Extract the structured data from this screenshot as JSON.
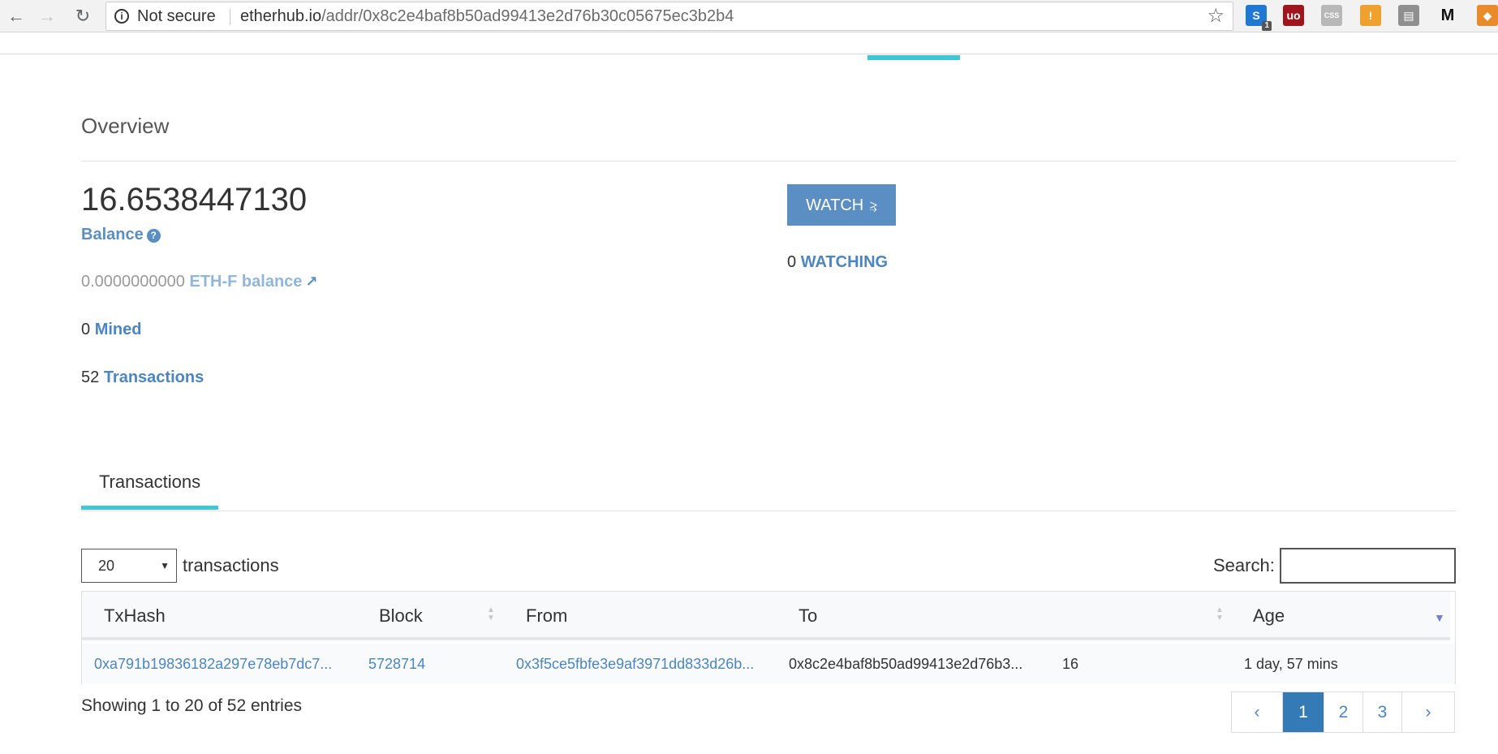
{
  "browser": {
    "security_label": "Not secure",
    "url_host": "etherhub.io",
    "url_path": "/addr/0x8c2e4baf8b50ad99413e2d76b30c05675ec3b2b4",
    "extensions": [
      {
        "name": "skype-extension",
        "letter": "S",
        "color": "#1e78d4",
        "badge": "1"
      },
      {
        "name": "ublock-extension",
        "letter": "uo",
        "color": "#a1141b"
      },
      {
        "name": "css-extension",
        "letter": "CSS",
        "color": "#b8b8b8"
      },
      {
        "name": "honey-extension",
        "letter": "!",
        "color": "#f0a02c"
      },
      {
        "name": "toolbox-extension",
        "letter": "▤",
        "color": "#8f8f8f"
      },
      {
        "name": "medium-extension",
        "letter": "M",
        "color": "#f2f2f2"
      },
      {
        "name": "metamask-extension",
        "letter": "◆",
        "color": "#e98b2a"
      }
    ]
  },
  "overview": {
    "title": "Overview",
    "balance_value": "16.6538447130",
    "balance_label": "Balance",
    "ethf_value": "0.0000000000",
    "ethf_label": "ETH-F balance",
    "mined_count": "0",
    "mined_label": "Mined",
    "tx_count": "52",
    "tx_label": "Transactions",
    "watch_button": "WATCH",
    "watching_count": "0",
    "watching_label": "WATCHING"
  },
  "tabs": {
    "transactions": "Transactions"
  },
  "table_controls": {
    "length_value": "20",
    "length_label": "transactions",
    "search_label": "Search:",
    "search_value": ""
  },
  "table": {
    "headers": {
      "txhash": "TxHash",
      "block": "Block",
      "from": "From",
      "to": "To",
      "age": "Age"
    },
    "rows": [
      {
        "txhash": "0xa791b19836182a297e78eb7dc7...",
        "block": "5728714",
        "from": "0x3f5ce5fbfe3e9af3971dd833d26b...",
        "to": "0x8c2e4baf8b50ad99413e2d76b3...",
        "value": "16",
        "age": "1 day, 57 mins"
      }
    ]
  },
  "pagination": {
    "info": "Showing 1 to 20 of 52 entries",
    "prev": "‹",
    "pages": [
      "1",
      "2",
      "3"
    ],
    "next": "›"
  }
}
